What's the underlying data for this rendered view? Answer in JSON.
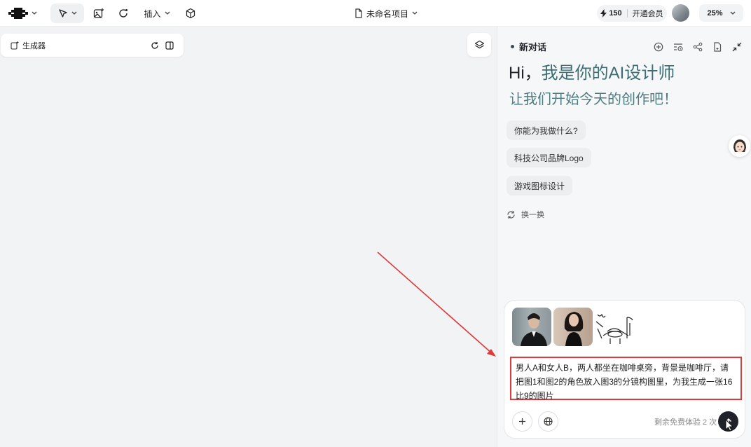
{
  "topbar": {
    "insert_label": "插入",
    "project_title": "未命名项目",
    "credits": "150",
    "member_label": "开通会员",
    "zoom": "25%"
  },
  "generator": {
    "label": "生成器"
  },
  "chat": {
    "title": "新对话",
    "greeting_line1_prefix": "Hi，",
    "greeting_line1_rest": "我是你的AI设计师",
    "greeting_line2": "让我们开始今天的创作吧！",
    "suggestions": [
      "你能为我做什么?",
      "科技公司品牌Logo",
      "游戏图标设计"
    ],
    "refresh_label": "换一换"
  },
  "composer": {
    "prompt_text": "男人A和女人B，两人都坐在咖啡桌旁，背景是咖啡厅，请把图1和图2的角色放入图3的分镜构图里，为我生成一张16比9的图片",
    "trial_text": "剩余免费体验 2 次"
  },
  "colors": {
    "accent_dark": "#1f2329",
    "greeting_teal": "#3c6e74",
    "annotation_red": "#e03a3a"
  }
}
